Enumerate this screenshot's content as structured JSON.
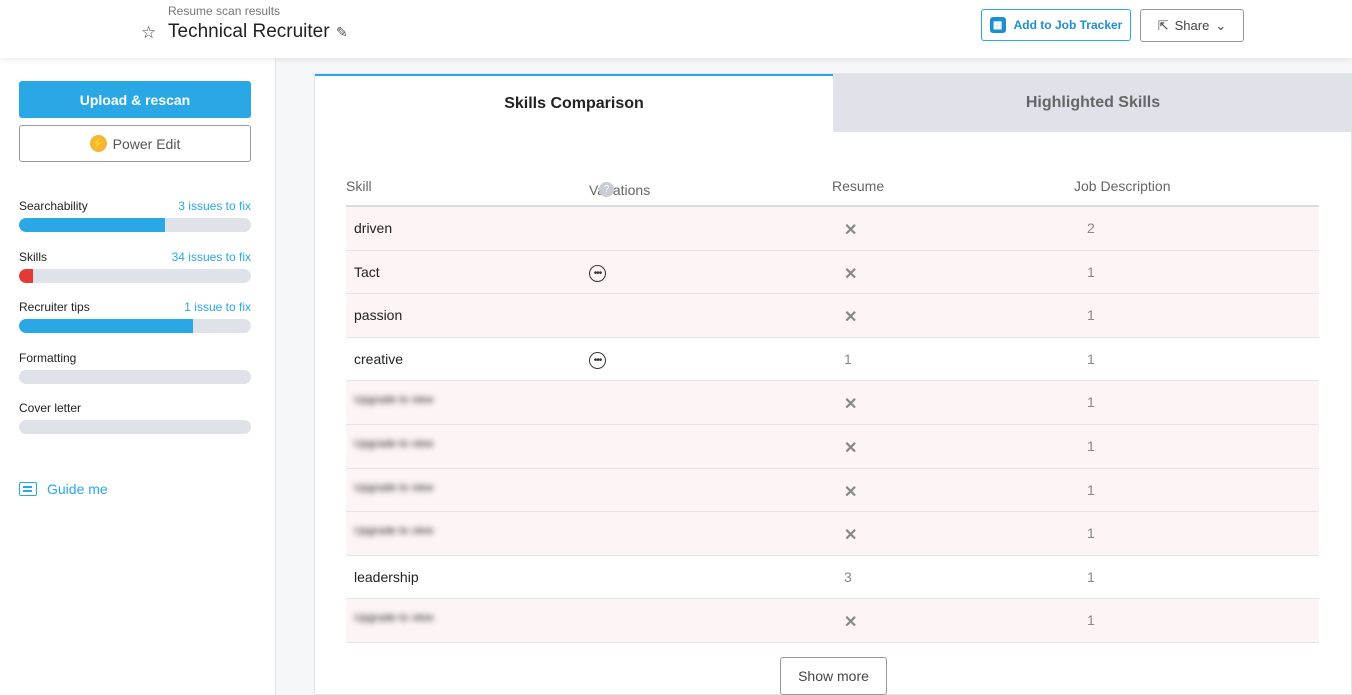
{
  "header": {
    "subtitle": "Resume scan results",
    "title": "Technical Recruiter",
    "star_icon": "☆",
    "edit_icon": "✎",
    "tracker_label": "Add to Job Tracker",
    "share_label": "Share",
    "share_icon": "⇱",
    "chevron_icon": "⌄"
  },
  "sidebar": {
    "upload_label": "Upload & rescan",
    "power_edit_label": "Power Edit",
    "bolt_icon": "⚡",
    "metrics": [
      {
        "label": "Searchability",
        "issues": "3 issues to fix",
        "progress": 0.63,
        "color": "#2aa7e5"
      },
      {
        "label": "Skills",
        "issues": "34 issues to fix",
        "progress": 0.06,
        "color": "#e53935"
      },
      {
        "label": "Recruiter tips",
        "issues": "1 issue to fix",
        "progress": 0.75,
        "color": "#2aa7e5"
      },
      {
        "label": "Formatting",
        "issues": "",
        "progress": 0,
        "color": "#2aa7e5"
      },
      {
        "label": "Cover letter",
        "issues": "",
        "progress": 0,
        "color": "#2aa7e5"
      }
    ],
    "guide_label": "Guide me"
  },
  "main": {
    "tabs": [
      {
        "label": "Skills Comparison",
        "active": true
      },
      {
        "label": "Highlighted Skills",
        "active": false
      }
    ],
    "columns": [
      "Skill",
      "Variations",
      "Resume",
      "Job Description"
    ],
    "help_icon": "?",
    "rows": [
      {
        "skill": "driven",
        "variations": false,
        "resume": "✕",
        "jd": "2",
        "missing": true,
        "blurred": false
      },
      {
        "skill": "Tact",
        "variations": true,
        "resume": "✕",
        "jd": "1",
        "missing": true,
        "blurred": false
      },
      {
        "skill": "passion",
        "variations": false,
        "resume": "✕",
        "jd": "1",
        "missing": true,
        "blurred": false
      },
      {
        "skill": "creative",
        "variations": true,
        "resume": "1",
        "jd": "1",
        "missing": false,
        "blurred": false
      },
      {
        "skill": "Upgrade to view",
        "variations": false,
        "resume": "✕",
        "jd": "1",
        "missing": true,
        "blurred": true
      },
      {
        "skill": "Upgrade to view",
        "variations": false,
        "resume": "✕",
        "jd": "1",
        "missing": true,
        "blurred": true
      },
      {
        "skill": "Upgrade to view",
        "variations": false,
        "resume": "✕",
        "jd": "1",
        "missing": true,
        "blurred": true
      },
      {
        "skill": "Upgrade to view",
        "variations": false,
        "resume": "✕",
        "jd": "1",
        "missing": true,
        "blurred": true
      },
      {
        "skill": "leadership",
        "variations": false,
        "resume": "3",
        "jd": "1",
        "missing": false,
        "blurred": false
      },
      {
        "skill": "Upgrade to view",
        "variations": false,
        "resume": "✕",
        "jd": "1",
        "missing": true,
        "blurred": true
      }
    ],
    "variations_icon": "•••",
    "show_more_label": "Show more"
  }
}
